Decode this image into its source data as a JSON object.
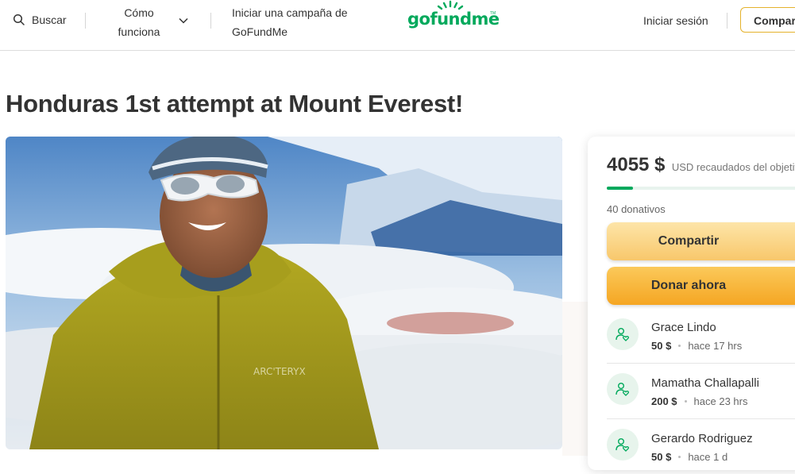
{
  "header": {
    "search_label": "Buscar",
    "how_it_works_line1": "Cómo",
    "how_it_works_line2": "funciona",
    "start_campaign_line1": "Iniciar una campaña de",
    "start_campaign_line2": "GoFundMe",
    "logo_text": "gofundme",
    "logo_tm": "TM",
    "login_label": "Iniciar sesión",
    "share_label": "Compartir"
  },
  "campaign": {
    "title": "Honduras 1st attempt at Mount Everest!"
  },
  "donation_card": {
    "amount": "4055 $",
    "amount_sub": "USD recaudados del objetivo",
    "progress_fraction": 0.13,
    "donations_count": "40 donativos",
    "share_button": "Compartir",
    "donate_button": "Donar ahora",
    "donors": [
      {
        "name": "Grace Lindo",
        "amount": "50 $",
        "time": "hace 17 hrs"
      },
      {
        "name": "Mamatha Challapalli",
        "amount": "200 $",
        "time": "hace 23 hrs"
      },
      {
        "name": "Gerardo Rodriguez",
        "amount": "50 $",
        "time": "hace 1 d"
      }
    ]
  },
  "colors": {
    "brand_green": "#02a95c",
    "share_yellow": "#f8c76b",
    "donate_orange": "#f5a623"
  }
}
